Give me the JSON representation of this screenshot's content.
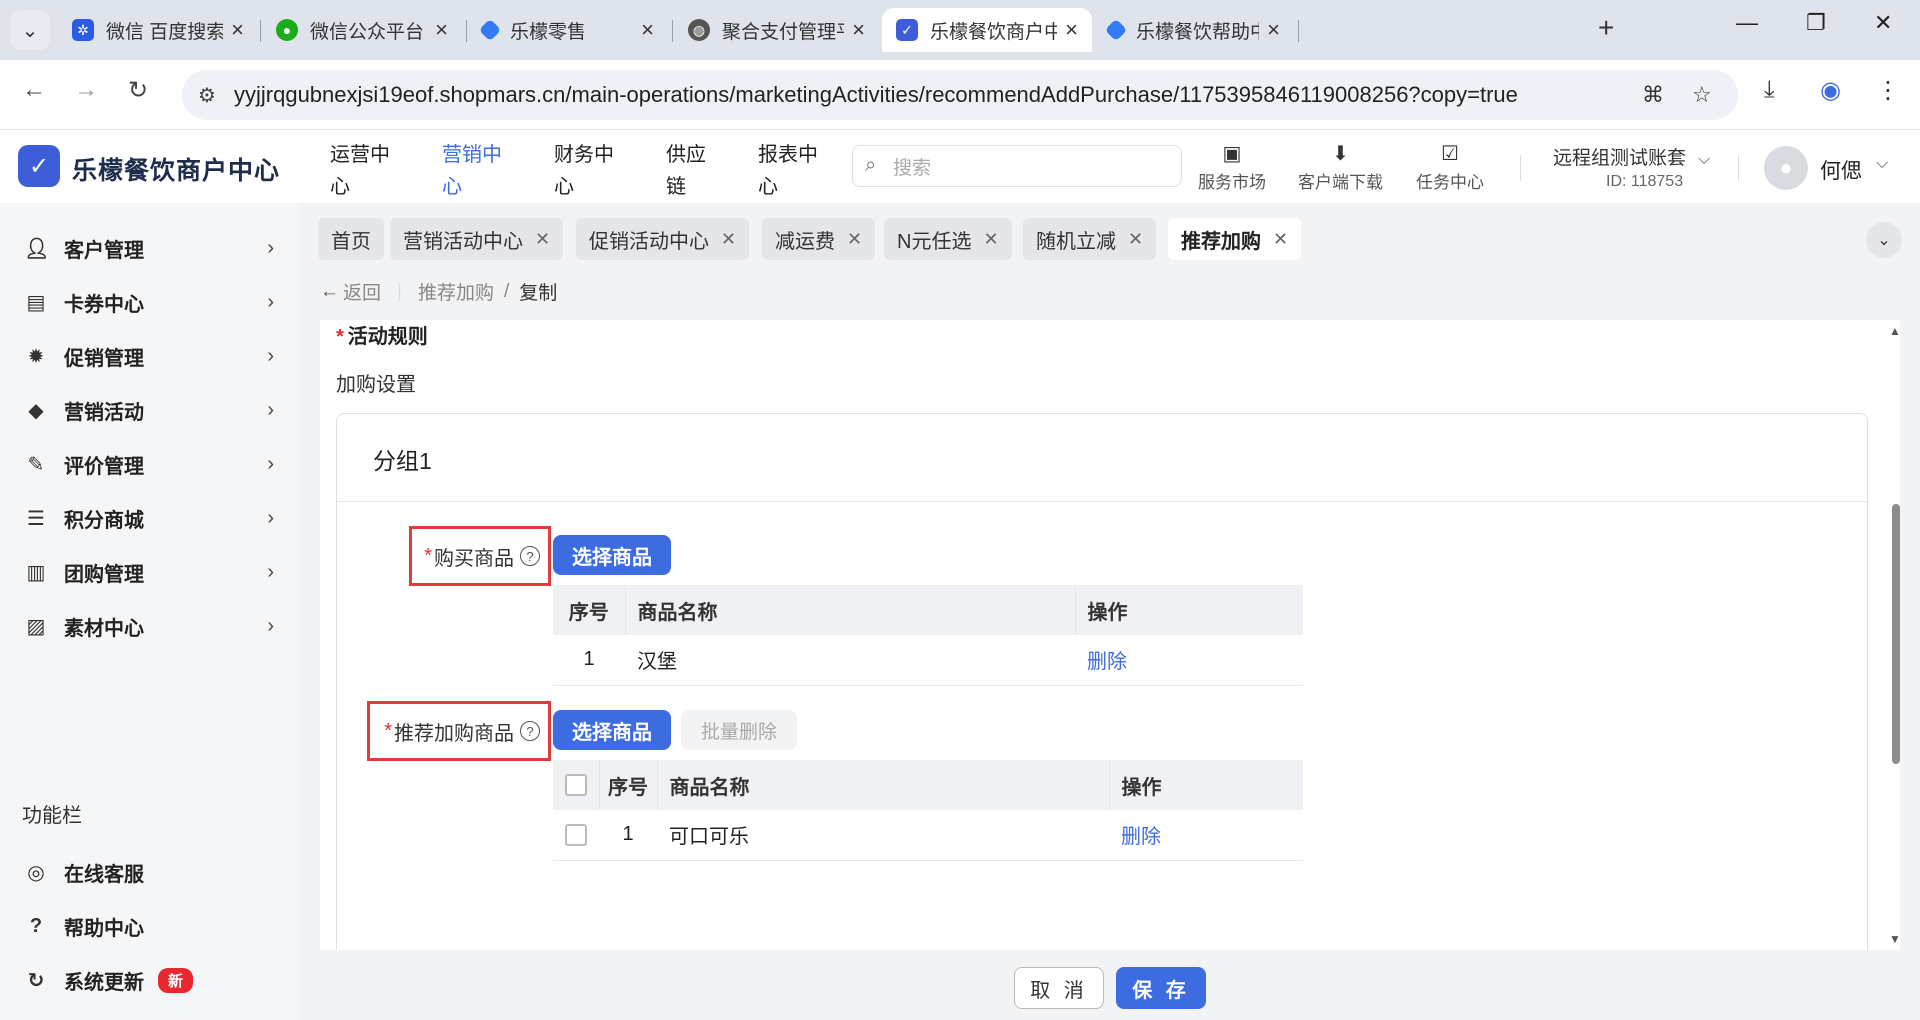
{
  "browser": {
    "tabs": [
      {
        "title": "微信 百度搜索",
        "icon": "baidu-paw-icon",
        "color": "#2b5ce6"
      },
      {
        "title": "微信公众平台",
        "icon": "wechat-icon",
        "color": "#1aad19"
      },
      {
        "title": "乐檬零售",
        "icon": "lemeng-icon",
        "color": "#2f7cf6"
      },
      {
        "title": "聚合支付管理平台",
        "icon": "globe-icon",
        "color": "#555555"
      },
      {
        "title": "乐檬餐饮商户中心",
        "icon": "lemeng-icon",
        "color": "#3d5ed8"
      },
      {
        "title": "乐檬餐饮帮助中心",
        "icon": "lemeng-icon",
        "color": "#2f7cf6"
      }
    ],
    "url": "yyjjrqgubnexjsi19eof.shopmars.cn/main-operations/marketingActivities/recommendAddPurchase/117539584611900825​6?copy=true"
  },
  "header": {
    "logo_text": "乐檬餐饮商户中心",
    "nav": [
      {
        "line1": "运营中",
        "line2": "心"
      },
      {
        "line1": "营销中",
        "line2": "心"
      },
      {
        "line1": "财务中",
        "line2": "心"
      },
      {
        "line1": "供应",
        "line2": "链"
      },
      {
        "line1": "报表中",
        "line2": "心"
      }
    ],
    "search_placeholder": "搜索",
    "tools": [
      "服务市场",
      "客户端下载",
      "任务中心"
    ],
    "account_name": "远程组测试账套",
    "account_id": "ID: 118753",
    "user_name": "何偲"
  },
  "sidebar": {
    "items": [
      {
        "label": "客户管理",
        "icon": "user-icon"
      },
      {
        "label": "卡券中心",
        "icon": "coupon-icon"
      },
      {
        "label": "促销管理",
        "icon": "promotion-icon"
      },
      {
        "label": "营销活动",
        "icon": "tag-icon"
      },
      {
        "label": "评价管理",
        "icon": "review-icon"
      },
      {
        "label": "积分商城",
        "icon": "points-icon"
      },
      {
        "label": "团购管理",
        "icon": "groupbuy-icon"
      },
      {
        "label": "素材中心",
        "icon": "material-icon"
      }
    ],
    "section_title": "功能栏",
    "func_items": [
      {
        "label": "在线客服",
        "icon": "headset-icon"
      },
      {
        "label": "帮助中心",
        "icon": "help-icon"
      },
      {
        "label": "系统更新",
        "icon": "refresh-icon"
      }
    ],
    "new_badge": "新"
  },
  "page_tabs": [
    "首页",
    "营销活动中心",
    "促销活动中心",
    "减运费",
    "N元任选",
    "随机立减",
    "推荐加购"
  ],
  "breadcrumb": {
    "back": "返回",
    "parent": "推荐加购",
    "sep": "/",
    "current": "复制"
  },
  "form": {
    "rule_title": "活动规则",
    "sub_title": "加购设置",
    "group_title": "分组1",
    "buy_label": "购买商品",
    "select_btn": "选择商品",
    "buy_table": {
      "headers": [
        "序号",
        "商品名称",
        "操作"
      ],
      "rows": [
        {
          "no": "1",
          "name": "汉堡",
          "action": "删除"
        }
      ]
    },
    "rec_label": "推荐加购商品",
    "batch_delete_btn": "批量删除",
    "rec_table": {
      "headers": [
        "序号",
        "商品名称",
        "操作"
      ],
      "rows": [
        {
          "no": "1",
          "name": "可口可乐",
          "action": "删除"
        }
      ]
    }
  },
  "footer": {
    "cancel": "取 消",
    "save": "保 存"
  },
  "colors": {
    "primary": "#3d6be0",
    "highlight_border": "#e23b3b",
    "badge": "#e8282f"
  }
}
